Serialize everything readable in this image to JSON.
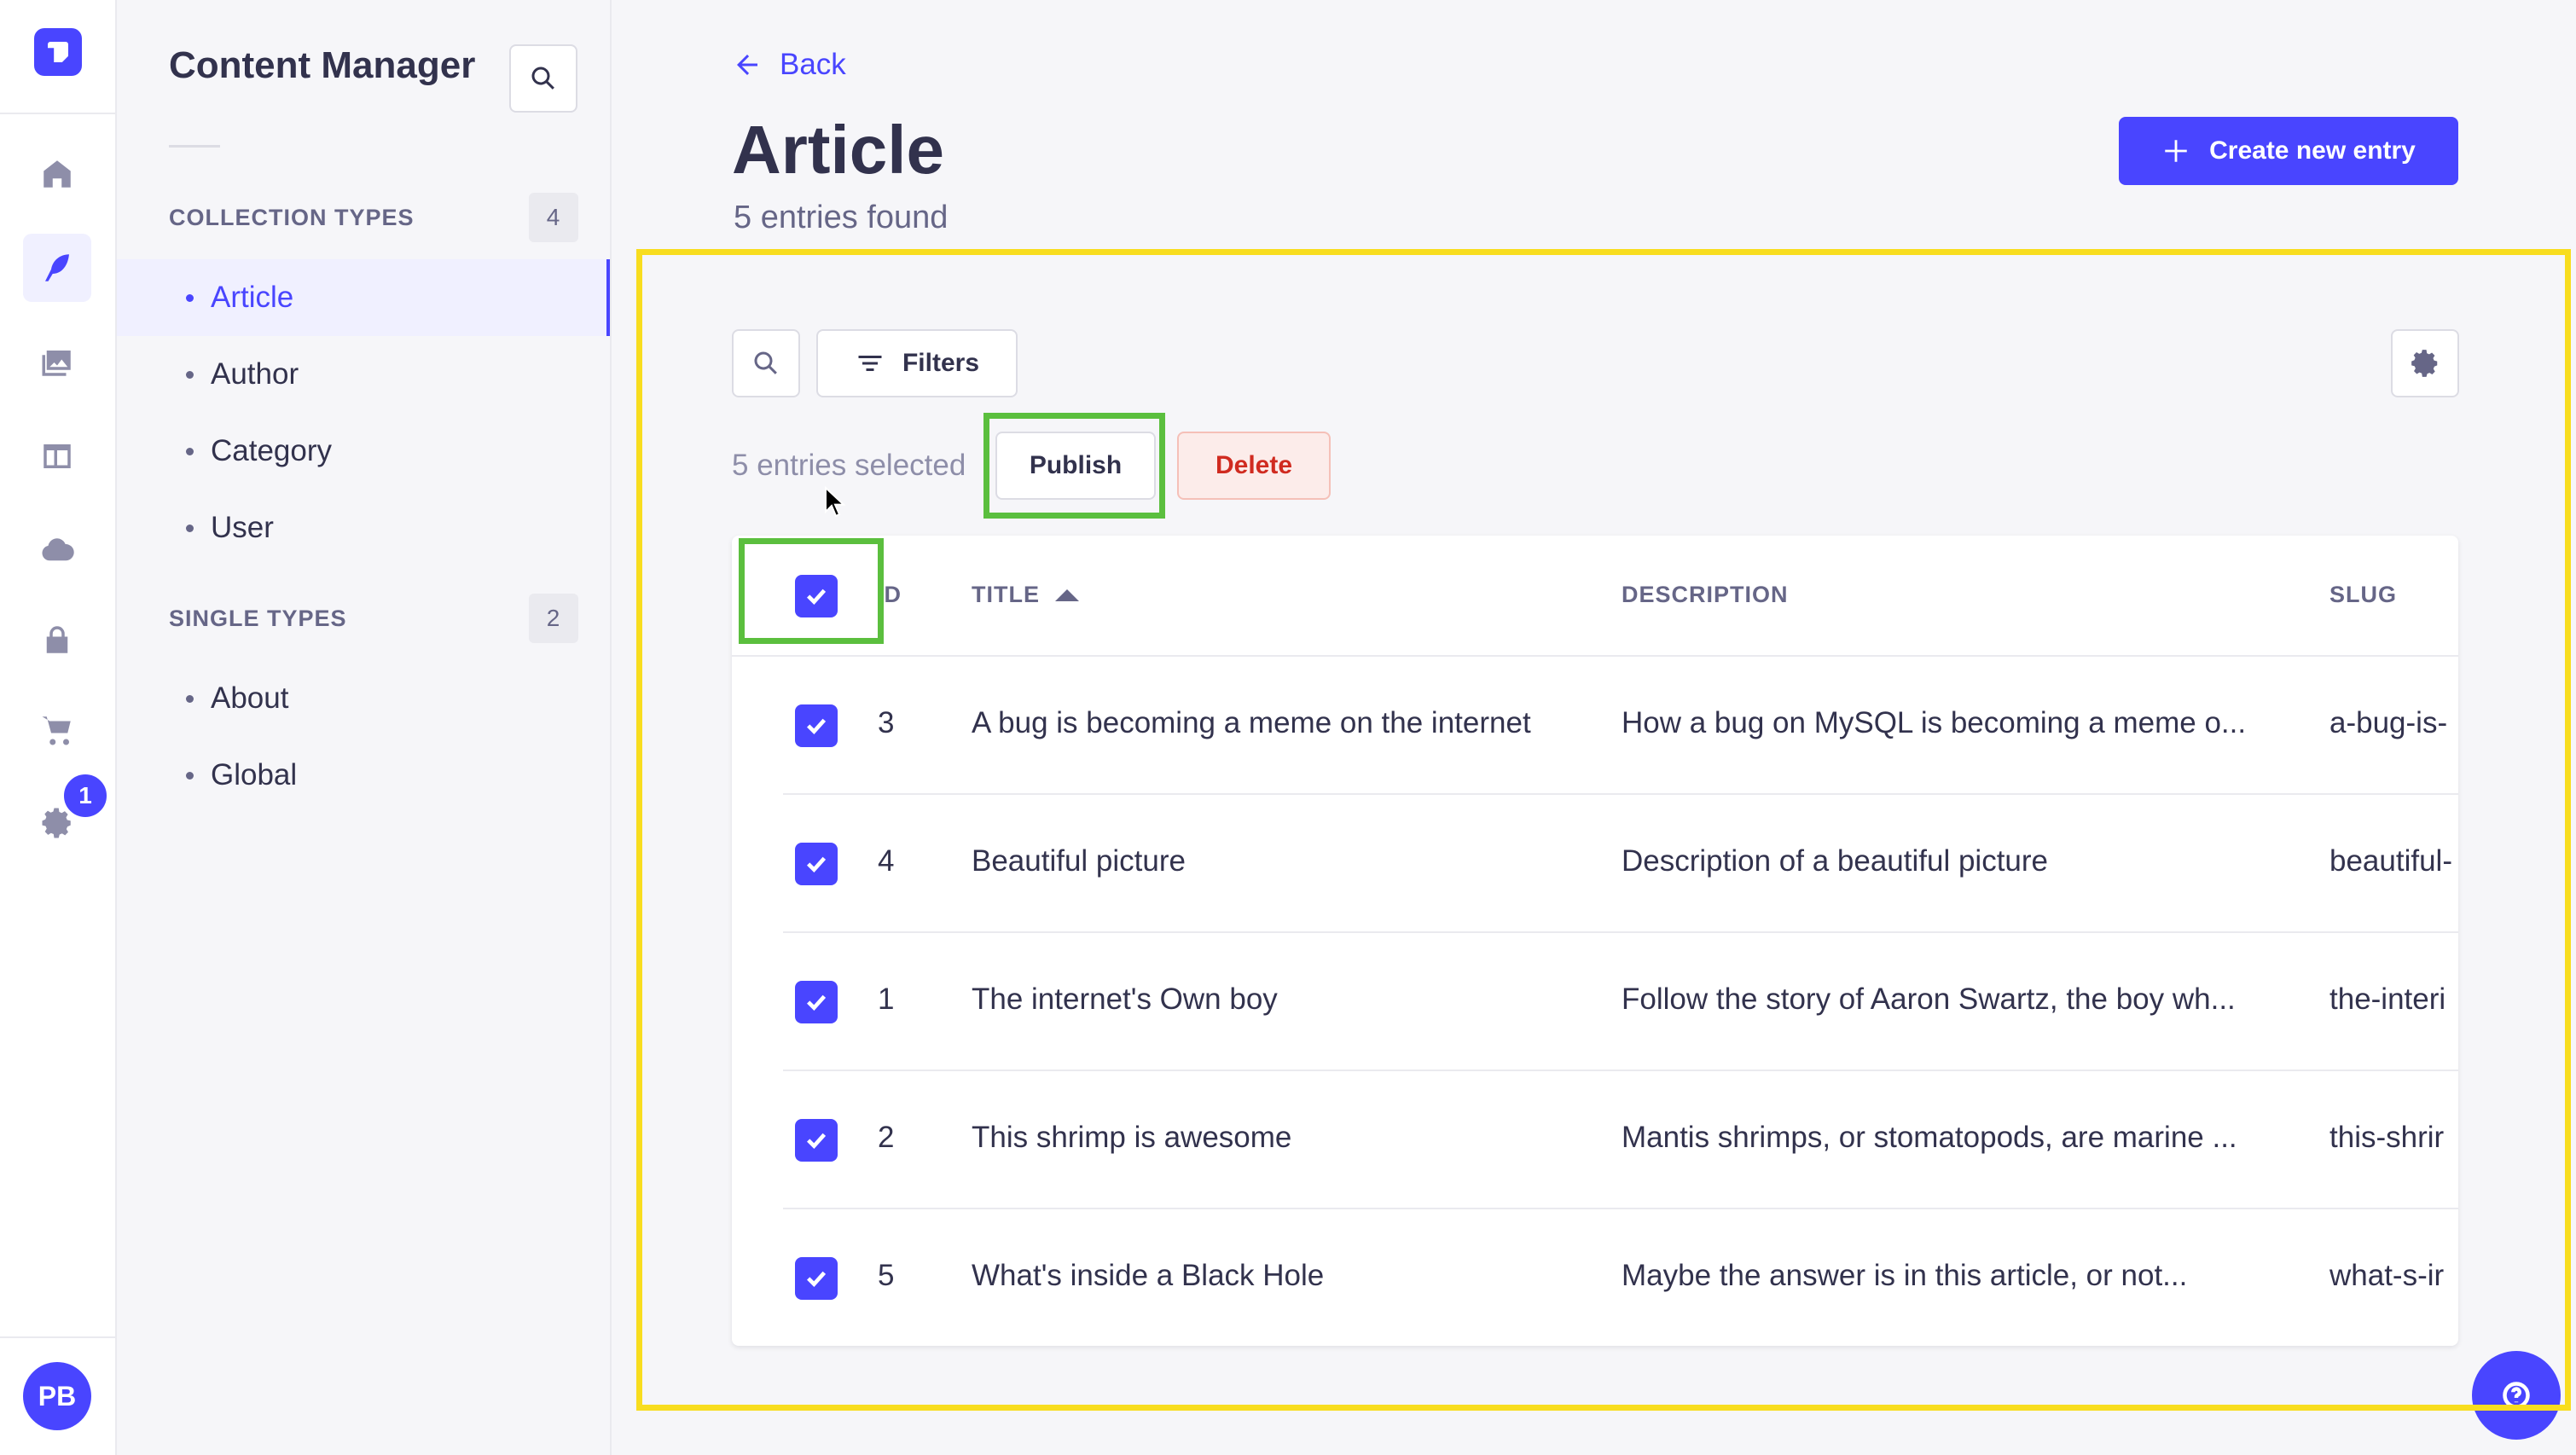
{
  "rail": {
    "notification_count": "1",
    "avatar_initials": "PB",
    "icons": [
      "home-icon",
      "feather-icon",
      "media-library-icon",
      "layout-icon",
      "cloud-icon",
      "lock-icon",
      "cart-icon",
      "settings-icon"
    ]
  },
  "subnav": {
    "title": "Content Manager",
    "collection_types": {
      "label": "COLLECTION TYPES",
      "count": "4",
      "items": [
        {
          "label": "Article"
        },
        {
          "label": "Author"
        },
        {
          "label": "Category"
        },
        {
          "label": "User"
        }
      ]
    },
    "single_types": {
      "label": "SINGLE TYPES",
      "count": "2",
      "items": [
        {
          "label": "About"
        },
        {
          "label": "Global"
        }
      ]
    }
  },
  "header": {
    "back_label": "Back",
    "title": "Article",
    "subtitle": "5 entries found",
    "create_label": "Create new entry"
  },
  "toolbar": {
    "filters_label": "Filters",
    "selected_text": "5 entries selected",
    "publish_label": "Publish",
    "delete_label": "Delete"
  },
  "table": {
    "columns": [
      "ID",
      "TITLE",
      "DESCRIPTION",
      "SLUG"
    ],
    "rows": [
      {
        "id": "3",
        "title": "A bug is becoming a meme on the internet",
        "description": "How a bug on MySQL is becoming a meme o...",
        "slug": "a-bug-is-"
      },
      {
        "id": "4",
        "title": "Beautiful picture",
        "description": "Description of a beautiful picture",
        "slug": "beautiful-"
      },
      {
        "id": "1",
        "title": "The internet's Own boy",
        "description": "Follow the story of Aaron Swartz, the boy wh...",
        "slug": "the-interi"
      },
      {
        "id": "2",
        "title": "This shrimp is awesome",
        "description": "Mantis shrimps, or stomatopods, are marine ...",
        "slug": "this-shrir"
      },
      {
        "id": "5",
        "title": "What's inside a Black Hole",
        "description": "Maybe the answer is in this article, or not...",
        "slug": "what-s-ir"
      }
    ]
  },
  "colors": {
    "primary": "#4945ff",
    "danger": "#d02b20",
    "highlight_yellow": "#f8dd1f",
    "highlight_green": "#5bbf3e"
  }
}
